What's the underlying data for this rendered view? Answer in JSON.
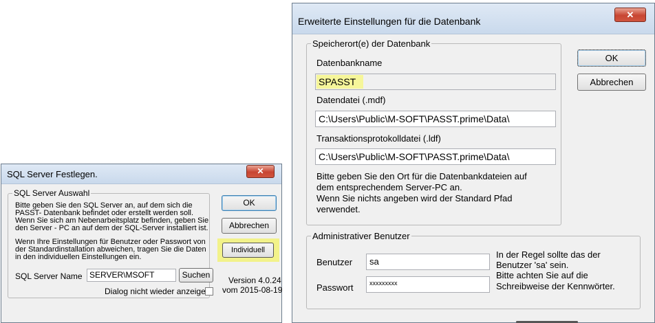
{
  "small_dialog": {
    "title": "SQL Server Festlegen.",
    "close_glyph": "✕",
    "group_title": "SQL Server Auswahl",
    "instructions_1": [
      "Bitte geben Sie den SQL Server an, auf dem sich die",
      "PASST- Datenbank befindet oder erstellt werden soll.",
      "Wenn Sie sich am Nebenarbeitsplatz befinden, geben Sie",
      "den Server - PC an auf dem der SQL-Server installiert ist."
    ],
    "instructions_2": [
      "Wenn Ihre Einstellungen für Benutzer oder Passwort von",
      "der Standardinstallation abweichen, tragen Sie die Daten",
      "in den individuellen Einstellungen ein."
    ],
    "ok_label": "OK",
    "cancel_label": "Abbrechen",
    "individual_label": "Individuell",
    "server_name_label": "SQL Server Name",
    "server_name_value": "SERVER\\MSOFT",
    "search_label": "Suchen",
    "dont_show_label": "Dialog nicht wieder anzeigen.",
    "version_line1": "Version 4.0.24",
    "version_line2": "vom 2015-08-19",
    "highlight_color": "#f2f28a"
  },
  "large_dialog": {
    "title": "Erweiterte Einstellungen für die Datenbank",
    "close_glyph": "✕",
    "storage_group_title": "Speicherort(e) der Datenbank",
    "db_name_label": "Datenbankname",
    "db_name_value": "SPASST",
    "mdf_label": "Datendatei (.mdf)",
    "mdf_value": "C:\\Users\\Public\\M-SOFT\\PASST.prime\\Data\\",
    "ldf_label": "Transaktionsprotokolldatei (.ldf)",
    "ldf_value": "C:\\Users\\Public\\M-SOFT\\PASST.prime\\Data\\",
    "hint_lines": [
      "Bitte geben Sie den Ort für die Datenbankdateien auf",
      "dem entsprechendem Server-PC an.",
      "Wenn Sie nichts angeben wird der Standard Pfad",
      "verwendet."
    ],
    "ok_label": "OK",
    "cancel_label": "Abbrechen",
    "admin_group_title": "Administrativer Benutzer",
    "user_label": "Benutzer",
    "user_value": "sa",
    "password_label": "Passwort",
    "password_value": "xxxxxxxxx",
    "user_hint_lines": [
      "In der Regel sollte das der",
      "Benutzer 'sa' sein."
    ],
    "password_hint_lines": [
      "Bitte achten Sie auf die",
      "Schreibweise der Kennwörter."
    ],
    "highlight_color": "#f6f69a"
  }
}
